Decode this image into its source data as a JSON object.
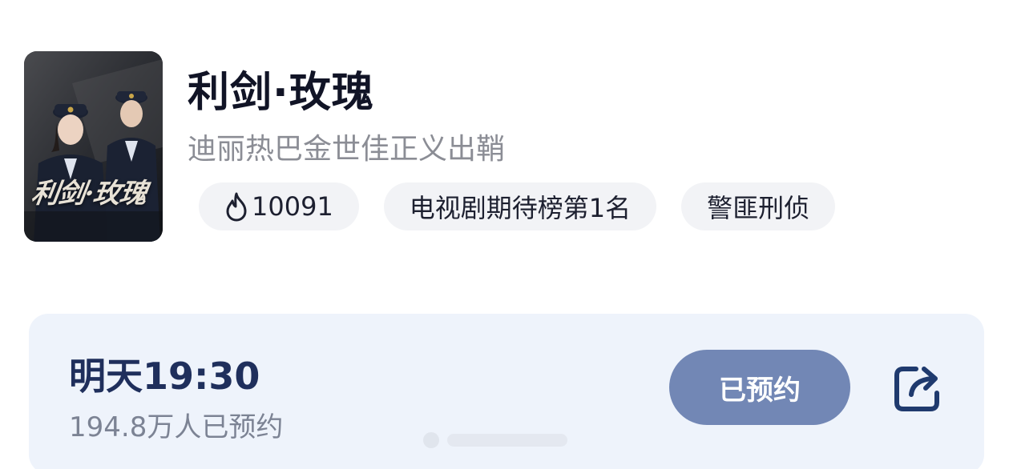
{
  "show": {
    "poster_title": "利剑·玫瑰",
    "title": "利剑·玫瑰",
    "subtitle": "迪丽热巴金世佳正义出鞘"
  },
  "chips": {
    "heat_icon": "flame-icon",
    "heat_value": "10091",
    "rank_label": "电视剧期待榜第1名",
    "genre_label": "警匪刑侦"
  },
  "reservation": {
    "time": "明天19:30",
    "count": "194.8万人已预约",
    "button_label": "已预约",
    "share_icon": "share-icon"
  },
  "colors": {
    "title": "#111426",
    "subtitle": "#8b8d95",
    "chip_bg": "#f2f3f6",
    "card_bg": "#eef3fb",
    "time_text": "#1f2f5c",
    "button_bg": "#7287b5",
    "share_icon": "#1f3a6e"
  }
}
